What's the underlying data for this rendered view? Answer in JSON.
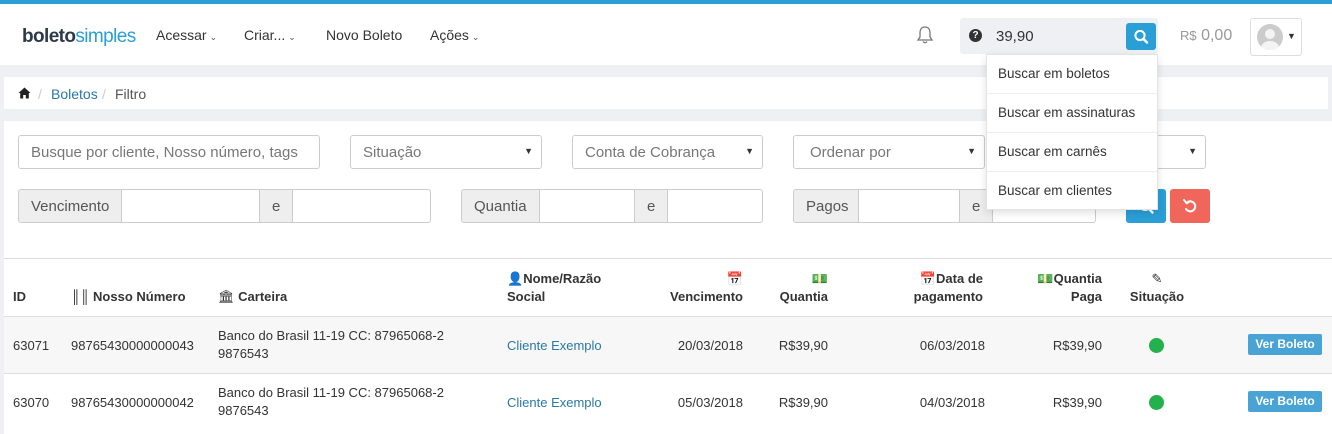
{
  "brand": {
    "bold": "boleto",
    "light": "simples"
  },
  "nav": {
    "items": [
      {
        "label": "Acessar",
        "caret": true
      },
      {
        "label": "Criar...",
        "caret": true
      },
      {
        "label": "Novo Boleto",
        "caret": false
      },
      {
        "label": "Ações",
        "caret": true
      }
    ]
  },
  "search": {
    "value": "39,90",
    "help_icon": "question-circle-icon",
    "button_icon": "search-icon"
  },
  "search_dropdown": [
    "Buscar em boletos",
    "Buscar em assinaturas",
    "Buscar em carnês",
    "Buscar em clientes"
  ],
  "balance": {
    "currency": "R$",
    "amount": "0,00"
  },
  "breadcrumb": {
    "home_icon": "home-icon",
    "items": [
      "Boletos",
      "Filtro"
    ]
  },
  "filters": {
    "query_placeholder": "Busque por cliente, Nosso número, tags",
    "situacao": "Situação",
    "conta": "Conta de Cobrança",
    "ordenar": "Ordenar por",
    "vencimento_label": "Vencimento",
    "quantia_label": "Quantia",
    "pagos_label": "Pagos",
    "and_label": "e"
  },
  "table": {
    "headers": {
      "id": "ID",
      "nosso_numero": "Nosso Número",
      "carteira": "Carteira",
      "nome_1": "Nome/Razão",
      "nome_2": "Social",
      "vencimento": "Vencimento",
      "quantia": "Quantia",
      "data_pag_1": "Data de",
      "data_pag_2": "pagamento",
      "qpaga_1": "Quantia",
      "qpaga_2": "Paga",
      "situacao": "Situação"
    },
    "rows": [
      {
        "id": "63071",
        "nosso_numero": "98765430000000043",
        "carteira_1": "Banco do Brasil 11-19 CC: 87965068-2",
        "carteira_2": "9876543",
        "cliente": "Cliente Exemplo",
        "vencimento": "20/03/2018",
        "quantia": "R$39,90",
        "data_pagamento": "06/03/2018",
        "quantia_paga": "R$39,90",
        "acao": "Ver Boleto",
        "status_color": "#22b14c"
      },
      {
        "id": "63070",
        "nosso_numero": "98765430000000042",
        "carteira_1": "Banco do Brasil 11-19 CC: 87965068-2",
        "carteira_2": "9876543",
        "cliente": "Cliente Exemplo",
        "vencimento": "05/03/2018",
        "quantia": "R$39,90",
        "data_pagamento": "04/03/2018",
        "quantia_paga": "R$39,90",
        "acao": "Ver Boleto",
        "status_color": "#22b14c"
      }
    ]
  },
  "colors": {
    "accent": "#2a9fd6",
    "danger": "#f0665a",
    "link": "#2a78a8",
    "status_paid": "#22b14c"
  }
}
